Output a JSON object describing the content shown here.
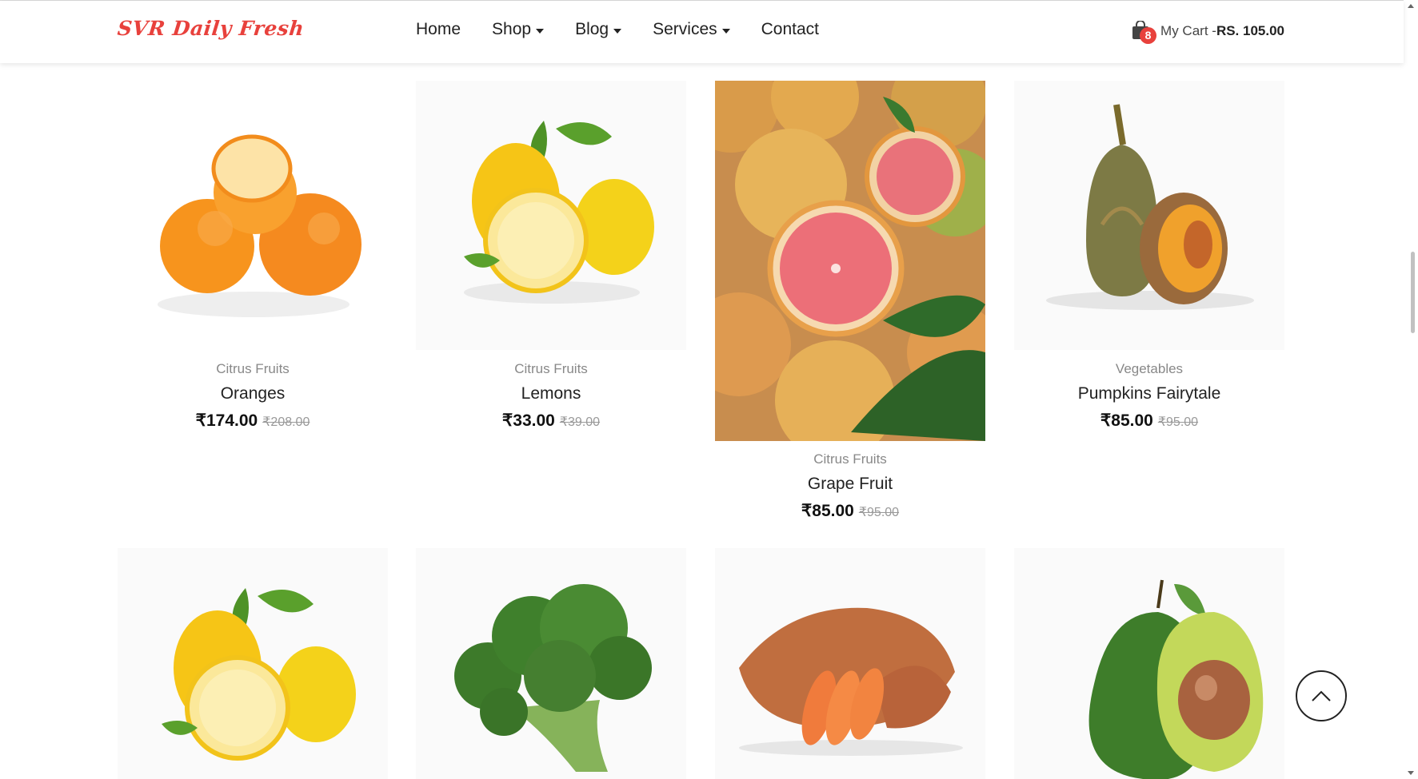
{
  "header": {
    "logo": "SVR Daily Fresh",
    "nav": [
      {
        "label": "Home",
        "dropdown": false
      },
      {
        "label": "Shop",
        "dropdown": true
      },
      {
        "label": "Blog",
        "dropdown": true
      },
      {
        "label": "Services",
        "dropdown": true
      },
      {
        "label": "Contact",
        "dropdown": false
      }
    ],
    "cart": {
      "count": "8",
      "label": "My Cart -",
      "amount": "RS. 105.00"
    }
  },
  "products_row1": [
    {
      "category": "Citrus Fruits",
      "name": "Oranges",
      "price": "₹174.00",
      "old_price": "₹208.00",
      "image": "oranges"
    },
    {
      "category": "Citrus Fruits",
      "name": "Lemons",
      "price": "₹33.00",
      "old_price": "₹39.00",
      "image": "lemons"
    },
    {
      "category": "Citrus Fruits",
      "name": "Grape Fruit",
      "price": "₹85.00",
      "old_price": "₹95.00",
      "image": "grapefruit"
    },
    {
      "category": "Vegetables",
      "name": "Pumpkins Fairytale",
      "price": "₹85.00",
      "old_price": "₹95.00",
      "image": "pumpkin"
    }
  ],
  "products_row2": [
    {
      "image": "lemons"
    },
    {
      "image": "broccoli"
    },
    {
      "image": "sweet-potato"
    },
    {
      "image": "avocado"
    }
  ],
  "icons": {
    "cart": "shopping-bag-icon",
    "scroll_top": "chevron-up-icon"
  },
  "colors": {
    "brand": "#e8413c",
    "text": "#222222",
    "muted": "#888888"
  }
}
